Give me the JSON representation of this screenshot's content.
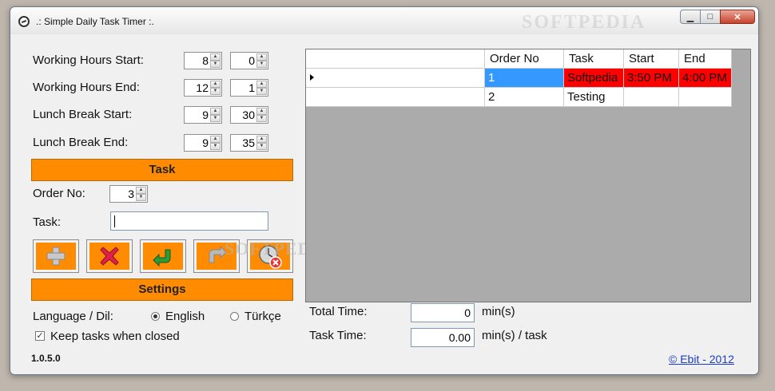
{
  "window": {
    "title": ".: Simple Daily Task Timer :.",
    "watermark": "SOFTPEDIA"
  },
  "titlebar_buttons": {
    "minimize": "▁",
    "maximize": "□",
    "close": "✕"
  },
  "working_hours": {
    "start_label": "Working Hours Start:",
    "start_hour": "8",
    "start_min": "0",
    "end_label": "Working Hours End:",
    "end_hour": "12",
    "end_min": "1"
  },
  "lunch_break": {
    "start_label": "Lunch Break Start:",
    "start_hour": "9",
    "start_min": "30",
    "end_label": "Lunch Break End:",
    "end_hour": "9",
    "end_min": "35"
  },
  "task_section": {
    "header": "Task",
    "order_label": "Order No:",
    "order_value": "3",
    "task_label": "Task:",
    "task_value": ""
  },
  "actions": [
    {
      "name": "add-task-button",
      "icon": "plus-icon"
    },
    {
      "name": "delete-task-button",
      "icon": "x-icon"
    },
    {
      "name": "start-task-button",
      "icon": "green-arrow-icon"
    },
    {
      "name": "undo-task-button",
      "icon": "grey-arrow-icon"
    },
    {
      "name": "clear-all-button",
      "icon": "clock-delete-icon"
    }
  ],
  "settings": {
    "header": "Settings",
    "language_label": "Language / Dil:",
    "lang_english": "English",
    "lang_turkish": "Türkçe",
    "selected": "English",
    "keep_tasks_label": "Keep tasks when closed",
    "keep_tasks_checked": true
  },
  "grid": {
    "columns": [
      "Order No",
      "Task",
      "Start",
      "End"
    ],
    "rows": [
      {
        "order": "1",
        "task": "Softpedia",
        "start": "3:50 PM",
        "end": "4:00 PM",
        "selected": true
      },
      {
        "order": "2",
        "task": "Testing",
        "start": "",
        "end": "",
        "selected": false
      }
    ],
    "colors": {
      "selected_bg": "#3399ff",
      "highlight_bg": "#ff0000"
    }
  },
  "totals": {
    "total_label": "Total Time:",
    "total_value": "0",
    "total_unit": "min(s)",
    "task_label": "Task Time:",
    "task_value": "0.00",
    "task_unit": "min(s) / task"
  },
  "footer": {
    "version": "1.0.5.0",
    "copyright": "© Ebit - 2012"
  },
  "colors": {
    "accent": "#ff8c00"
  }
}
